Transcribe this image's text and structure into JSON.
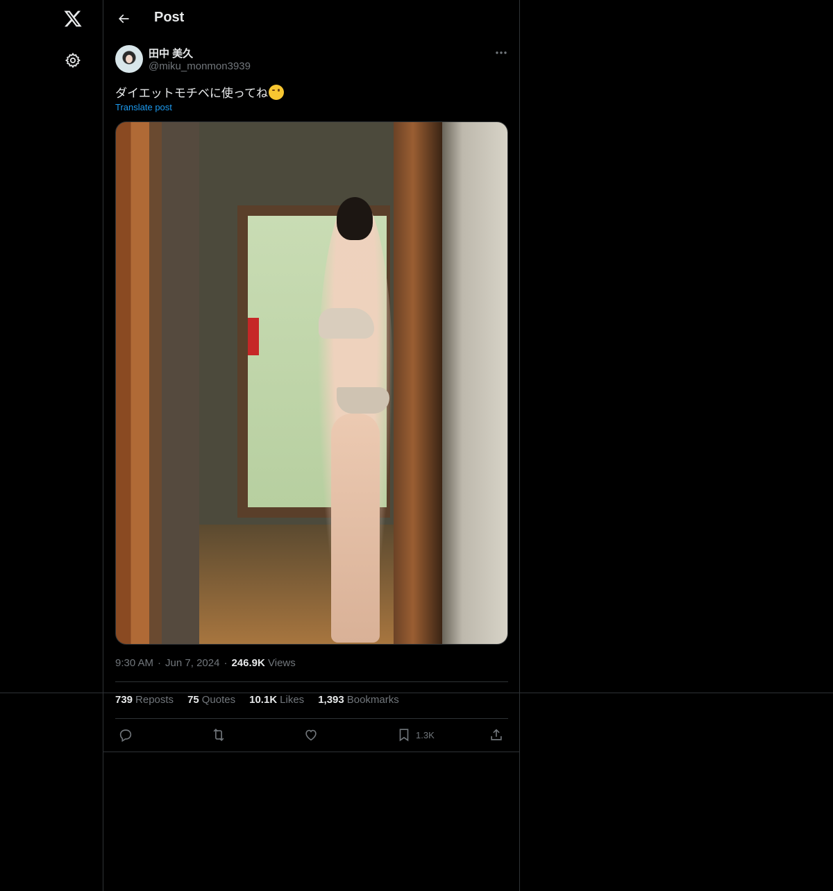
{
  "nav": {
    "logo_icon": "x-logo-icon",
    "settings_icon": "gear-icon"
  },
  "header": {
    "title": "Post",
    "back_icon": "arrow-left-icon"
  },
  "post": {
    "author": {
      "display_name": "田中 美久",
      "handle": "@miku_monmon3939"
    },
    "text": "ダイエットモチベに使ってね",
    "emoji": "winking-face",
    "translate_label": "Translate post",
    "time": "9:30 AM",
    "date": "Jun 7, 2024",
    "views_count": "246.9K",
    "views_label": "Views"
  },
  "stats": [
    {
      "count": "739",
      "label": "Reposts"
    },
    {
      "count": "75",
      "label": "Quotes"
    },
    {
      "count": "10.1K",
      "label": "Likes"
    },
    {
      "count": "1,393",
      "label": "Bookmarks"
    }
  ],
  "actions": {
    "bookmark_count": "1.3K"
  },
  "colors": {
    "background": "#000000",
    "text_primary": "#e7e9ea",
    "text_secondary": "#71767b",
    "border": "#2f3336",
    "accent": "#1d9bf0"
  }
}
